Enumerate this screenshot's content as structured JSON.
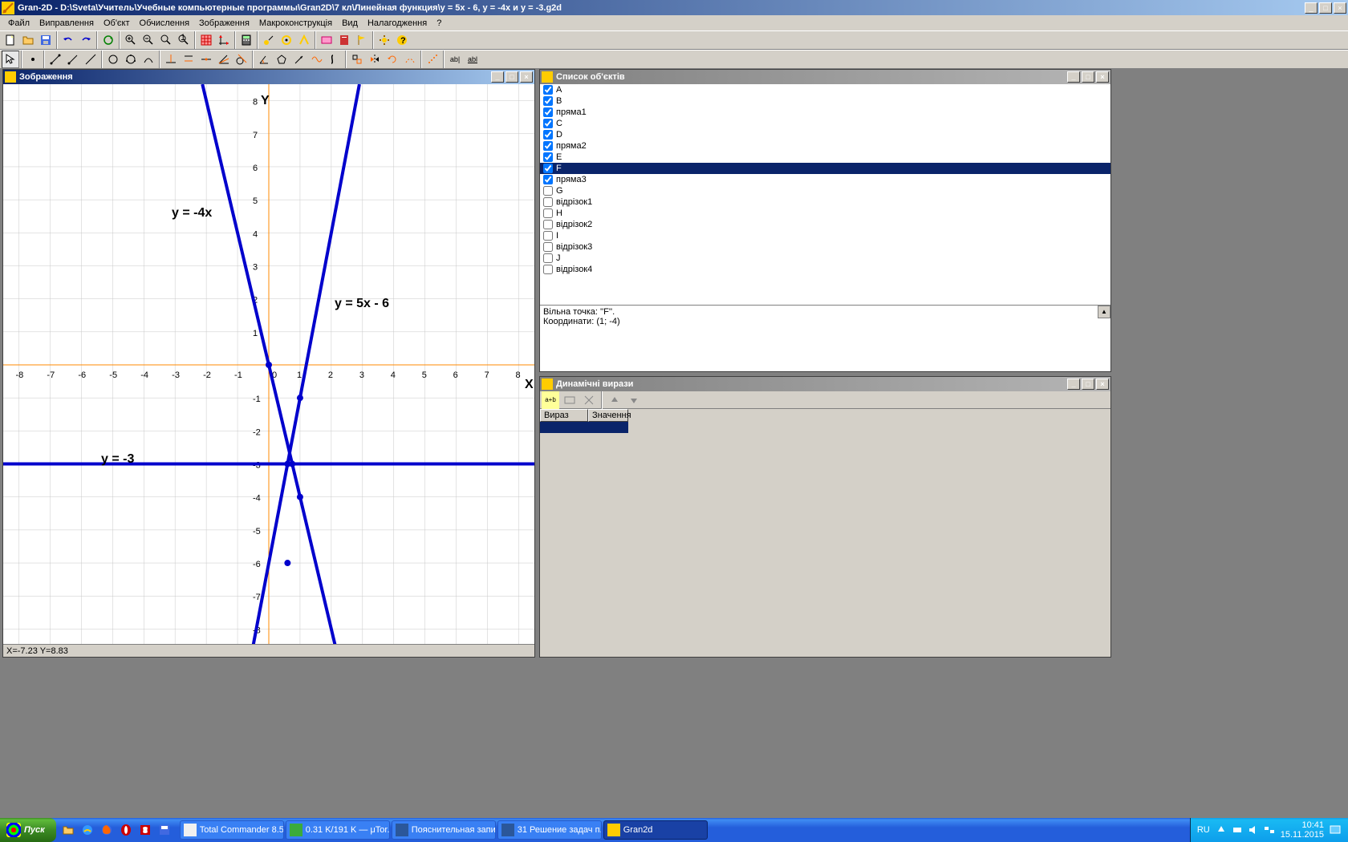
{
  "title": "Gran-2D - D:\\Sveta\\Учитель\\Учебные компьютерные программы\\Gran2D\\7 кл\\Линейная функция\\y = 5x - 6, y = -4x и y = -3.g2d",
  "menu": [
    "Файл",
    "Виправлення",
    "Об'єкт",
    "Обчислення",
    "Зображення",
    "Макроконструкція",
    "Вид",
    "Налагодження",
    "?"
  ],
  "win_zobr": "Зображення",
  "win_obj": "Список об'єктів",
  "win_dyn": "Динамічні вирази",
  "status_coords": "X=-7.23 Y=8.83",
  "info_line1": "Вільна точка: ''F''.",
  "info_line2": "Координати: (1; -4)",
  "dyn_cols": {
    "c1": "Вираз",
    "c2": "Значення"
  },
  "objects": [
    {
      "label": "A",
      "checked": true
    },
    {
      "label": "B",
      "checked": true
    },
    {
      "label": "пряма1",
      "checked": true
    },
    {
      "label": "C",
      "checked": true
    },
    {
      "label": "D",
      "checked": true
    },
    {
      "label": "пряма2",
      "checked": true
    },
    {
      "label": "E",
      "checked": true
    },
    {
      "label": "F",
      "checked": true,
      "selected": true
    },
    {
      "label": "пряма3",
      "checked": true
    },
    {
      "label": "G",
      "checked": false
    },
    {
      "label": "відрізок1",
      "checked": false
    },
    {
      "label": "H",
      "checked": false
    },
    {
      "label": "відрізок2",
      "checked": false
    },
    {
      "label": "I",
      "checked": false
    },
    {
      "label": "відрізок3",
      "checked": false
    },
    {
      "label": "J",
      "checked": false
    },
    {
      "label": "відрізок4",
      "checked": false
    }
  ],
  "graph_labels": {
    "l1": "y = -4x",
    "l2": "y = 5x - 6",
    "l3": "y = -3",
    "Y": "Y",
    "X": "X"
  },
  "axis_ticks_x": [
    "-8",
    "-7",
    "-6",
    "-5",
    "-4",
    "-3",
    "-2",
    "-1",
    "0",
    "1",
    "2",
    "3",
    "4",
    "5",
    "6",
    "7",
    "8"
  ],
  "axis_ticks_y": [
    "8",
    "7",
    "6",
    "5",
    "4",
    "3",
    "2",
    "1",
    "-1",
    "-2",
    "-3",
    "-4",
    "-5",
    "-6",
    "-7",
    "-8"
  ],
  "chart_data": {
    "type": "line",
    "xlim": [
      -8.5,
      8.5
    ],
    "ylim": [
      -8.5,
      8.5
    ],
    "series": [
      {
        "name": "y = 5x - 6",
        "equation": "y=5x-6",
        "points": [
          [
            -0.5,
            -8.5
          ],
          [
            2.9,
            8.5
          ]
        ]
      },
      {
        "name": "y = -4x",
        "equation": "y=-4x",
        "points": [
          [
            -2.125,
            8.5
          ],
          [
            2.125,
            -8.5
          ]
        ]
      },
      {
        "name": "y = -3",
        "equation": "y=-3",
        "points": [
          [
            -8.5,
            -3
          ],
          [
            8.5,
            -3
          ]
        ]
      }
    ],
    "grid": true
  },
  "taskbar": {
    "start": "Пуск",
    "items": [
      {
        "label": "Total Commander 8.5...",
        "color": "#f0f0f0"
      },
      {
        "label": "0.31 K/191 K — μTor...",
        "color": "#3bab3b"
      },
      {
        "label": "Пояснительная запи...",
        "color": "#2b579a"
      },
      {
        "label": "31 Решение задач п...",
        "color": "#2b579a"
      },
      {
        "label": "Gran2d",
        "color": "#ffcc00",
        "active": true
      }
    ],
    "lang": "RU",
    "time": "10:41",
    "date": "15.11.2015"
  }
}
